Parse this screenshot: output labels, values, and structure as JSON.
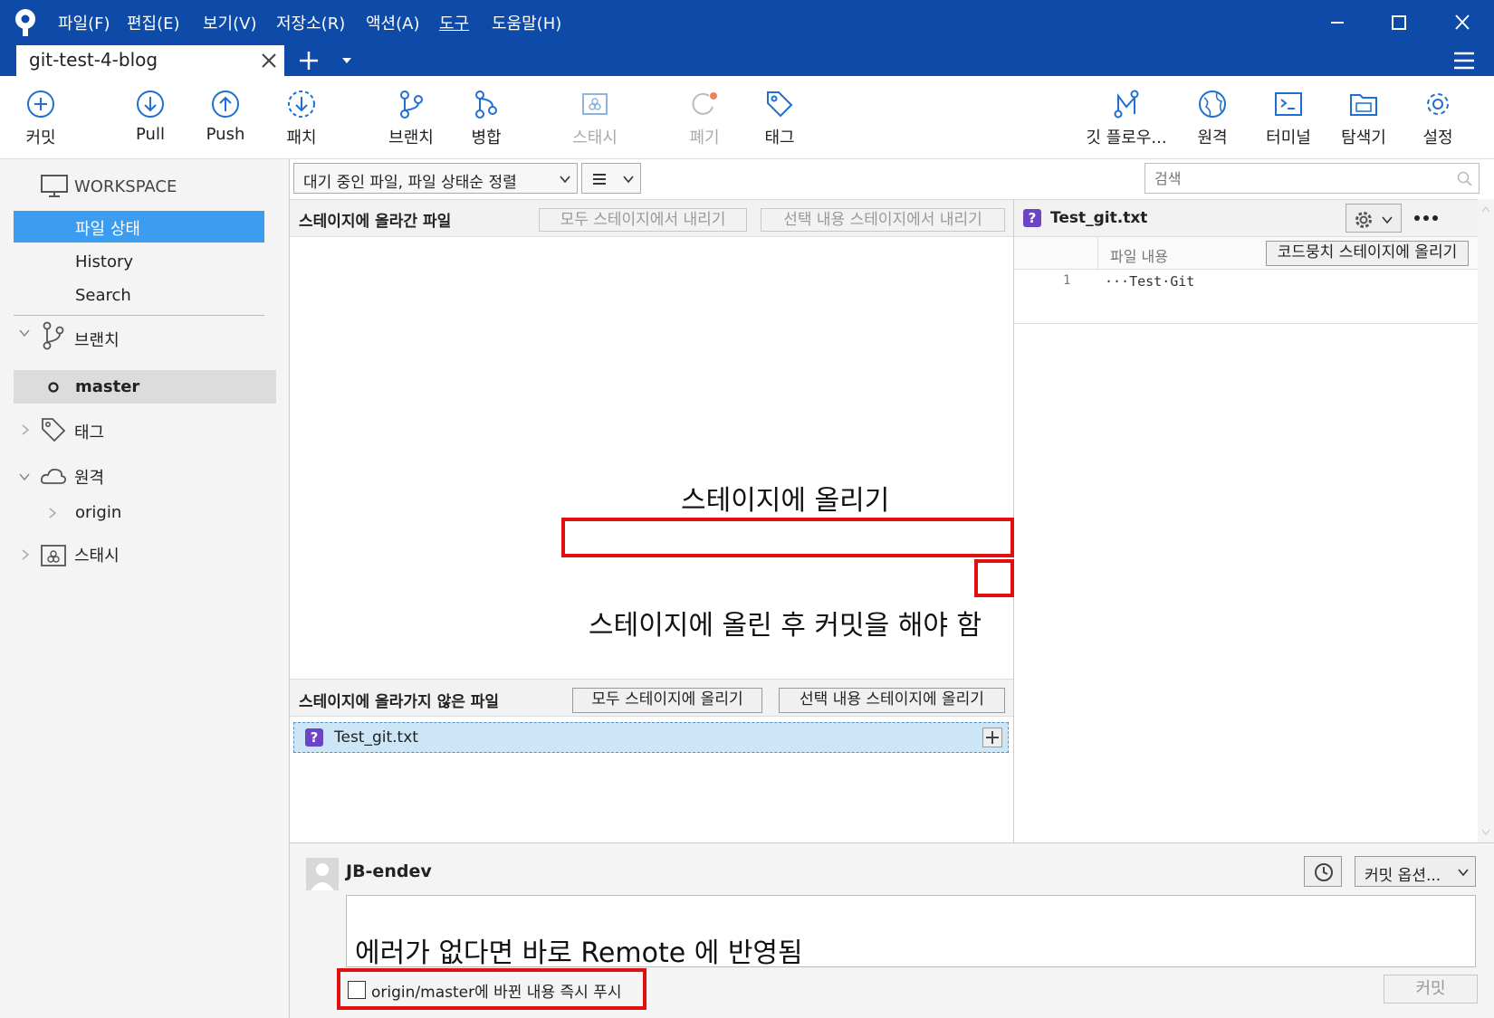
{
  "menu": [
    "파일(F)",
    "편집(E)",
    "보기(V)",
    "저장소(R)",
    "액션(A)",
    "도구",
    "도움말(H)"
  ],
  "tab": {
    "title": "git-test-4-blog"
  },
  "toolbar": {
    "commit": "커밋",
    "pull": "Pull",
    "push": "Push",
    "patch": "패치",
    "branch": "브랜치",
    "merge": "병합",
    "stash": "스태시",
    "discard": "폐기",
    "tag": "태그",
    "gitflow": "깃 플로우...",
    "remote": "원격",
    "terminal": "터미널",
    "explorer": "탐색기",
    "settings": "설정"
  },
  "sidebar": {
    "workspace": "WORKSPACE",
    "file_status": "파일 상태",
    "history": "History",
    "search": "Search",
    "branches": "브랜치",
    "master": "master",
    "tags": "태그",
    "remotes": "원격",
    "origin": "origin",
    "stashes": "스태시"
  },
  "filter": {
    "sort_select": "대기 중인 파일, 파일 상태순 정렬",
    "search_placeholder": "검색"
  },
  "staged": {
    "title": "스테이지에 올라간 파일",
    "unstage_all": "모두 스테이지에서 내리기",
    "unstage_selected": "선택 내용 스테이지에서 내리기"
  },
  "unstaged": {
    "title": "스테이지에 올라가지 않은 파일",
    "stage_all": "모두 스테이지에 올리기",
    "stage_selected": "선택 내용 스테이지에 올리기",
    "file": "Test_git.txt"
  },
  "diff": {
    "filename": "Test_git.txt",
    "col_header": "파일 내용",
    "stage_hunk": "코드뭉치 스테이지에 올리기",
    "line_no": "1",
    "line_text": "···Test·Git"
  },
  "commit": {
    "author": "JB-endev",
    "options": "커밋 옵션...",
    "push_label": "origin/master에 바뀐 내용 즉시 푸시",
    "submit": "커밋"
  },
  "annotations": {
    "stage": "스테이지에 올리기",
    "after_stage": "스테이지에 올린 후 커밋을 해야 함",
    "remote": "에러가 없다면 바로 Remote 에 반영됨"
  }
}
